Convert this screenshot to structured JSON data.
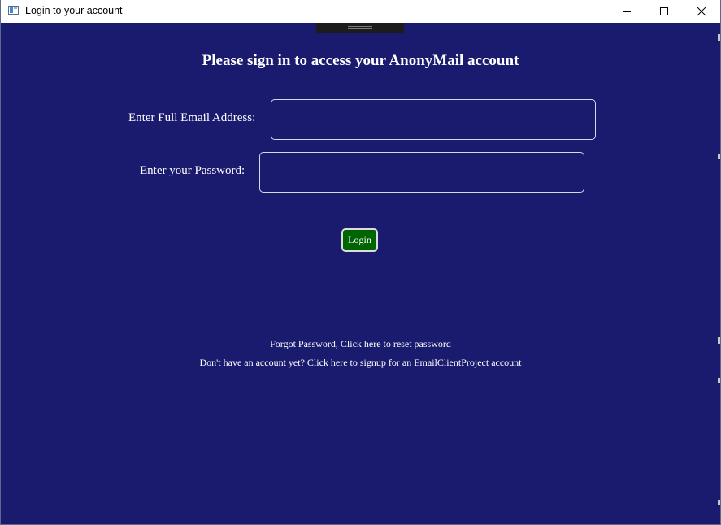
{
  "window": {
    "title": "Login to your account",
    "controls": {
      "minimize_icon": "minimize-icon",
      "maximize_icon": "maximize-icon",
      "close_icon": "close-icon"
    }
  },
  "colors": {
    "background": "#1a1a6e",
    "login_button": "#006400",
    "text": "#ffffff"
  },
  "form": {
    "heading": "Please sign in to access your AnonyMail account",
    "email_label": "Enter Full Email Address:",
    "email_value": "",
    "password_label": "Enter your Password:",
    "password_value": "",
    "login_label": "Login"
  },
  "links": {
    "forgot": "Forgot Password, Click here to reset password",
    "signup": "Don't have an account yet? Click here to signup for an EmailClientProject account"
  }
}
